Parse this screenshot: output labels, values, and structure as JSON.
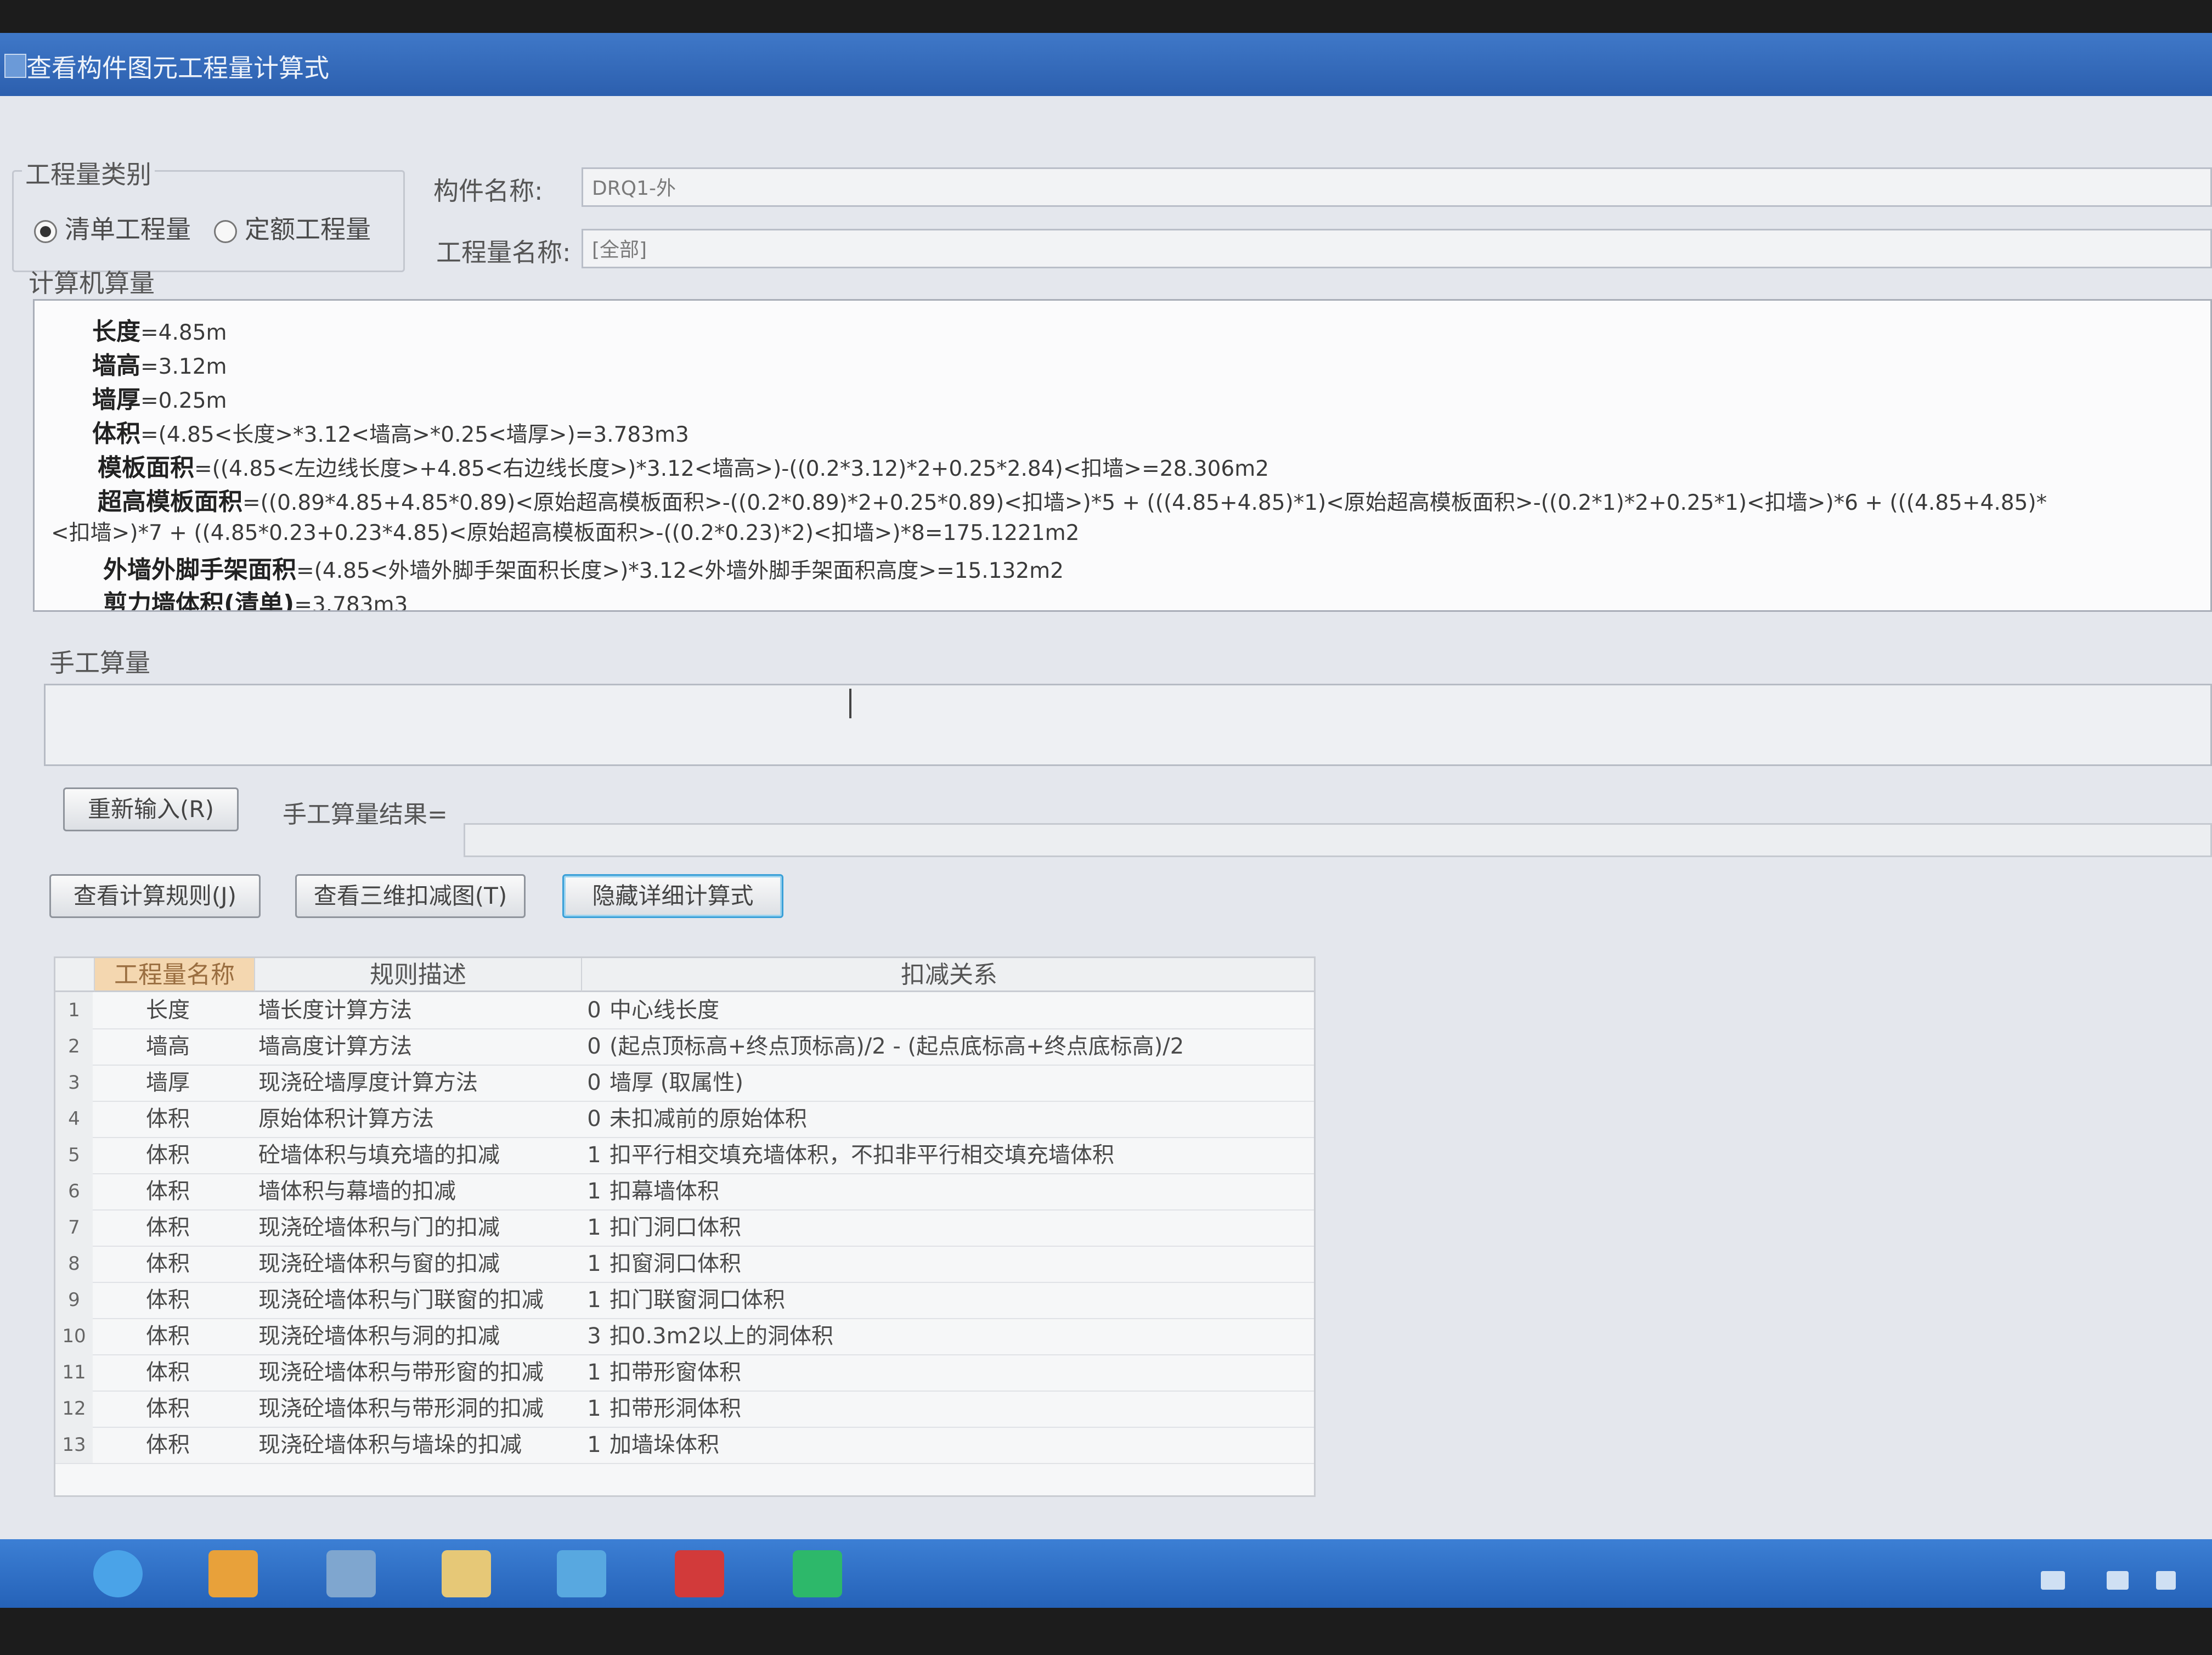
{
  "window": {
    "title": "查看构件图元工程量计算式"
  },
  "quantity_type": {
    "group_label": "工程量类别",
    "options": [
      {
        "label": "清单工程量",
        "selected": true
      },
      {
        "label": "定额工程量",
        "selected": false
      }
    ]
  },
  "component": {
    "name_label": "构件名称:",
    "name_value": "DRQ1-外",
    "quantity_name_label": "工程量名称:",
    "quantity_name_value": "[全部]"
  },
  "computer_calc": {
    "section_label": "计算机算量",
    "lines": [
      {
        "term": "长度",
        "expr": "=4.85m"
      },
      {
        "term": "墙高",
        "expr": "=3.12m"
      },
      {
        "term": "墙厚",
        "expr": "=0.25m"
      },
      {
        "term": "体积",
        "expr": "=(4.85<长度>*3.12<墙高>*0.25<墙厚>)=3.783m3"
      },
      {
        "term": "模板面积",
        "expr": "=((4.85<左边线长度>+4.85<右边线长度>)*3.12<墙高>)-((0.2*3.12)*2+0.25*2.84)<扣墙>=28.306m2"
      },
      {
        "term": "超高模板面积",
        "expr": "=((0.89*4.85+4.85*0.89)<原始超高模板面积>-((0.2*0.89)*2+0.25*0.89)<扣墙>)*5 + (((4.85+4.85)*1)<原始超高模板面积>-((0.2*1)*2+0.25*1)<扣墙>)*6 + (((4.85+4.85)*"
      },
      {
        "term": "",
        "expr": "<扣墙>)*7 + ((4.85*0.23+0.23*4.85)<原始超高模板面积>-((0.2*0.23)*2)<扣墙>)*8=175.1221m2"
      },
      {
        "term": "外墙外脚手架面积",
        "expr": "=(4.85<外墙外脚手架面积长度>)*3.12<外墙外脚手架面积高度>=15.132m2"
      },
      {
        "term": "剪力墙体积(清单)",
        "expr": "=3.783m3"
      }
    ]
  },
  "manual_calc": {
    "section_label": "手工算量",
    "value": "",
    "reinput_button": "重新输入(R)",
    "result_label": "手工算量结果="
  },
  "actions": {
    "view_rules": "查看计算规则(J)",
    "view_3d": "查看三维扣减图(T)",
    "hide_detail": "隐藏详细计算式"
  },
  "rules_table": {
    "headers": [
      "工程量名称",
      "规则描述",
      "扣减关系"
    ],
    "rows": [
      {
        "num": "1",
        "name": "长度",
        "desc": "墙长度计算方法",
        "code": "0",
        "relation": "中心线长度"
      },
      {
        "num": "2",
        "name": "墙高",
        "desc": "墙高度计算方法",
        "code": "0",
        "relation": "(起点顶标高+终点顶标高)/2 - (起点底标高+终点底标高)/2"
      },
      {
        "num": "3",
        "name": "墙厚",
        "desc": "现浇砼墙厚度计算方法",
        "code": "0",
        "relation": "墙厚 (取属性)"
      },
      {
        "num": "4",
        "name": "体积",
        "desc": "原始体积计算方法",
        "code": "0",
        "relation": "未扣减前的原始体积"
      },
      {
        "num": "5",
        "name": "体积",
        "desc": "砼墙体积与填充墙的扣减",
        "code": "1",
        "relation": "扣平行相交填充墙体积，不扣非平行相交填充墙体积"
      },
      {
        "num": "6",
        "name": "体积",
        "desc": "墙体积与幕墙的扣减",
        "code": "1",
        "relation": "扣幕墙体积"
      },
      {
        "num": "7",
        "name": "体积",
        "desc": "现浇砼墙体积与门的扣减",
        "code": "1",
        "relation": "扣门洞口体积"
      },
      {
        "num": "8",
        "name": "体积",
        "desc": "现浇砼墙体积与窗的扣减",
        "code": "1",
        "relation": "扣窗洞口体积"
      },
      {
        "num": "9",
        "name": "体积",
        "desc": "现浇砼墙体积与门联窗的扣减",
        "code": "1",
        "relation": "扣门联窗洞口体积"
      },
      {
        "num": "10",
        "name": "体积",
        "desc": "现浇砼墙体积与洞的扣减",
        "code": "3",
        "relation": "扣0.3m2以上的洞体积"
      },
      {
        "num": "11",
        "name": "体积",
        "desc": "现浇砼墙体积与带形窗的扣减",
        "code": "1",
        "relation": "扣带形窗体积"
      },
      {
        "num": "12",
        "name": "体积",
        "desc": "现浇砼墙体积与带形洞的扣减",
        "code": "1",
        "relation": "扣带形洞体积"
      },
      {
        "num": "13",
        "name": "体积",
        "desc": "现浇砼墙体积与墙垛的扣减",
        "code": "1",
        "relation": "加墙垛体积"
      }
    ]
  },
  "taskbar": {
    "items": [
      {
        "icon": "start-orb-icon",
        "color": "#4aa3e8"
      },
      {
        "icon": "pinwheel-app-icon",
        "color": "#e8a13a"
      },
      {
        "icon": "cad-app-icon",
        "color": "#7fa6cf"
      },
      {
        "icon": "folder-icon",
        "color": "#e6c877"
      },
      {
        "icon": "wps-icon",
        "color": "#58a8e0"
      },
      {
        "icon": "autocad-icon",
        "color": "#d23a3a"
      },
      {
        "icon": "glodon-app-icon",
        "color": "#2db86a"
      }
    ]
  }
}
